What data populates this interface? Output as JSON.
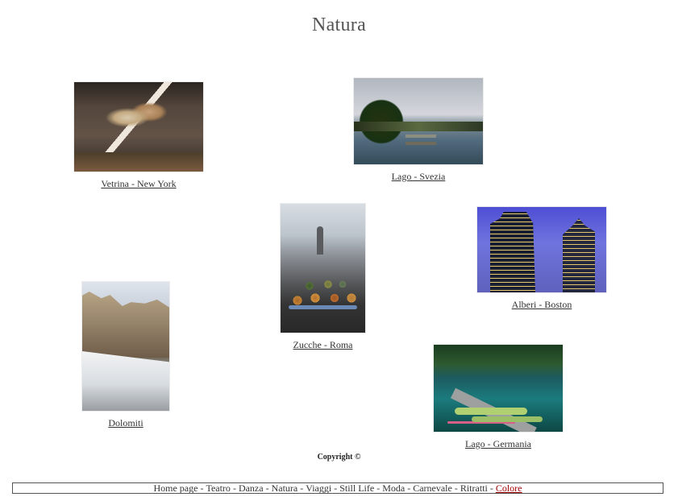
{
  "page": {
    "title": "Natura"
  },
  "gallery": [
    {
      "caption": "Vetrina  - New York",
      "photo_icon": "taxidermy-cats-photo"
    },
    {
      "caption": "Lago - Svezia",
      "photo_icon": "lake-sweden-photo"
    },
    {
      "caption": "Zucche - Roma",
      "photo_icon": "pumpkins-rome-photo"
    },
    {
      "caption": "Alberi - Boston",
      "photo_icon": "city-trees-boston-photo"
    },
    {
      "caption": "Dolomiti",
      "photo_icon": "mountains-photo"
    },
    {
      "caption": "Lago - Germania",
      "photo_icon": "lake-germany-photo"
    }
  ],
  "copyright": "Copyright ©",
  "footer_nav": {
    "items": [
      {
        "label": "Home page"
      },
      {
        "label": "Teatro"
      },
      {
        "label": "Danza"
      },
      {
        "label": "Natura"
      },
      {
        "label": "Viaggi"
      },
      {
        "label": "Still Life"
      },
      {
        "label": "Moda"
      },
      {
        "label": "Carnevale"
      },
      {
        "label": "Ritratti"
      },
      {
        "label": "Colore",
        "accent": "#a00000"
      }
    ],
    "separator": "-"
  }
}
